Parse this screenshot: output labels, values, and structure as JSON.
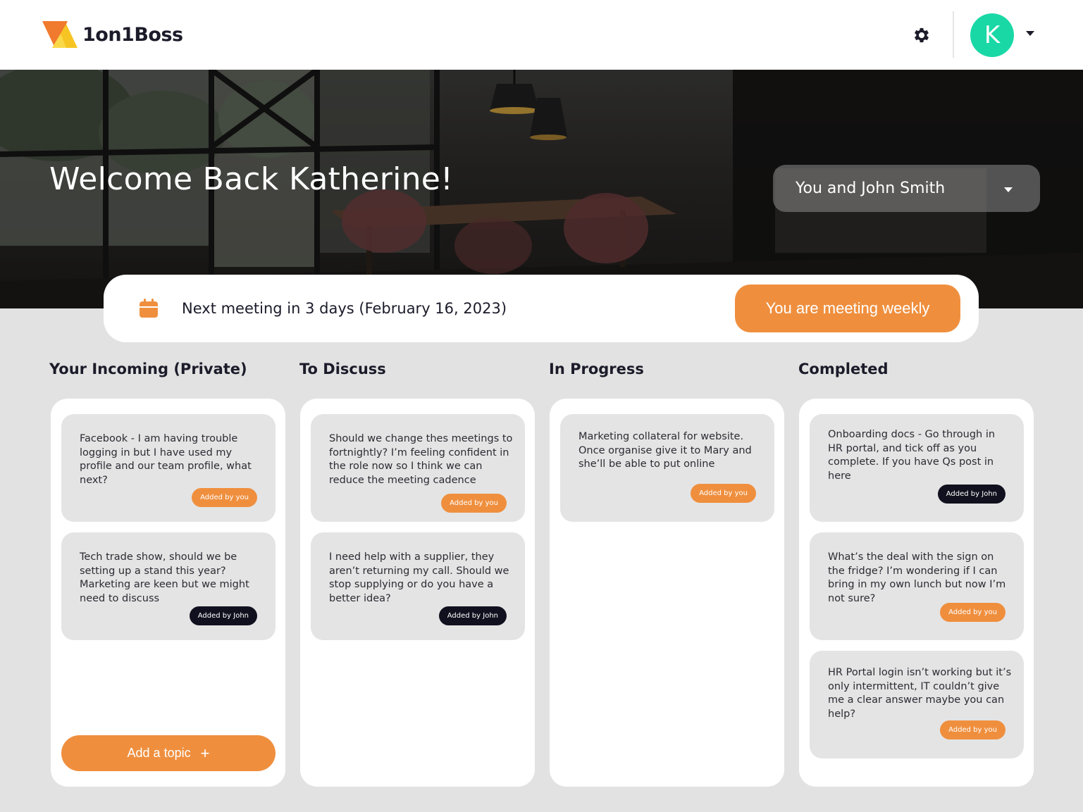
{
  "app": {
    "name": "1on1Boss"
  },
  "header": {
    "avatar_initial": "K",
    "icons": {
      "settings": "gear-icon",
      "menu": "chevron-down-icon"
    }
  },
  "hero": {
    "welcome": "Welcome Back Katherine!",
    "pair_select": "You and John Smith"
  },
  "meeting": {
    "next": "Next meeting in 3 days (February 16, 2023)",
    "frequency_button": "You are meeting weekly",
    "icon": "calendar-icon"
  },
  "colors": {
    "accent": "#ef8f3e",
    "avatar": "#19d8a6",
    "dark_tag": "#10101e",
    "background": "#e2e2e2"
  },
  "columns": [
    {
      "title": "Your Incoming (Private)",
      "cards": [
        {
          "text": "Facebook - I am having trouble logging in but I have used my profile and our team profile, what next?",
          "tag": "Added by you"
        },
        {
          "text": "Tech trade show, should we be setting up a stand this year? Marketing are keen but we might need to discuss",
          "tag": "Added by John"
        }
      ],
      "add_button": "Add a topic",
      "add_icon": "+"
    },
    {
      "title": "To Discuss",
      "cards": [
        {
          "text": "Should we change thes meetings to fortnightly? I’m feeling confident in the role now so I think we can reduce the meeting cadence",
          "tag": "Added by you"
        },
        {
          "text": "I need help with a supplier, they aren’t returning my call. Should we stop supplying or do you have a better idea?",
          "tag": "Added by John"
        }
      ]
    },
    {
      "title": "In Progress",
      "cards": [
        {
          "text": "Marketing collateral for website. Once organise give it to Mary and she’ll be able to put online",
          "tag": "Added by you"
        }
      ]
    },
    {
      "title": "Completed",
      "cards": [
        {
          "text": "Onboarding docs - Go through in HR portal, and tick off as you complete. If you have Qs post in here",
          "tag": "Added by John"
        },
        {
          "text": "What’s the deal with the sign on the fridge? I’m wondering if I can bring in my own lunch but now I’m not sure?",
          "tag": "Added by you"
        },
        {
          "text": "HR Portal login isn’t working but it’s only intermittent, IT couldn’t give me a clear answer maybe you can help?",
          "tag": "Added by you"
        }
      ]
    }
  ]
}
